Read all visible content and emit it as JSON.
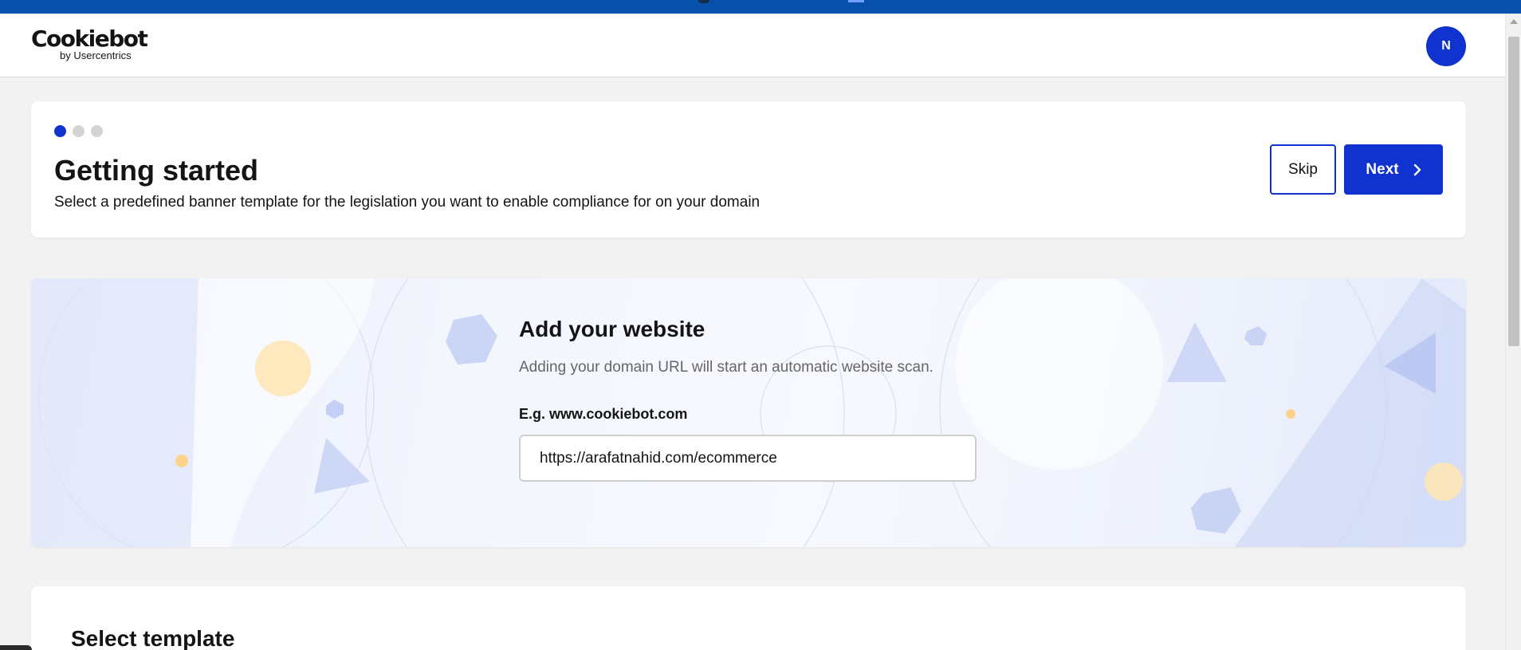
{
  "header": {
    "logo_main": "Cookiebot",
    "logo_sub": "by Usercentrics",
    "avatar_initial": "N"
  },
  "onboarding": {
    "steps_total": 3,
    "current_step": 1,
    "title": "Getting started",
    "subtitle": "Select a predefined banner template for the legislation you want to enable compliance for on your domain",
    "skip_label": "Skip",
    "next_label": "Next"
  },
  "website": {
    "title": "Add your website",
    "description": "Adding your domain URL will start an automatic website scan.",
    "field_label": "E.g. www.cookiebot.com",
    "field_value": "https://arafatnahid.com/ecommerce"
  },
  "template": {
    "title": "Select template"
  },
  "colors": {
    "brand_blue": "#1032cf",
    "top_strip": "#0751ad",
    "page_bg": "#f2f2f2"
  },
  "icons": {
    "next_chevron": "chevron-right-icon",
    "step_indicator": "step-dot"
  }
}
